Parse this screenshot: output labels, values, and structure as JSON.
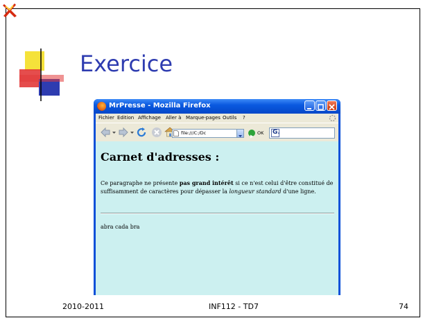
{
  "slide": {
    "title": "Exercice",
    "footer_left": "2010-2011",
    "footer_center": "INF112 - TD7",
    "footer_right": "74"
  },
  "browser": {
    "window_title": "MrPresse - Mozilla Firefox",
    "menu": [
      "Fichier",
      "Edition",
      "Affichage",
      "Aller à",
      "Marque-pages",
      "Outils",
      "?"
    ],
    "url": "file:///C:/Dc",
    "go_label": "OK",
    "search_value": "G."
  },
  "page": {
    "heading": "Carnet d'adresses :",
    "para_before_bold": "Ce paragraphe ne présente ",
    "para_bold": "pas grand intérêt",
    "para_middle": " si ce n'est celui d'être constitué de suffisamment de caractères pour dépasser la ",
    "para_italic": "longueur standard",
    "para_end": " d'une ligne.",
    "line2": "abra cada bra"
  },
  "colors": {
    "title": "#2e3cb0",
    "page_background": "#ccf0f0",
    "titlebar": "#0a50d8"
  },
  "icons": [
    "app-logo-icon",
    "firefox-icon",
    "back-icon",
    "forward-icon",
    "reload-icon",
    "stop-icon",
    "home-icon",
    "page-icon",
    "go-icon",
    "search-engine-icon",
    "throbber-icon",
    "minimize-icon",
    "maximize-icon",
    "close-icon"
  ]
}
